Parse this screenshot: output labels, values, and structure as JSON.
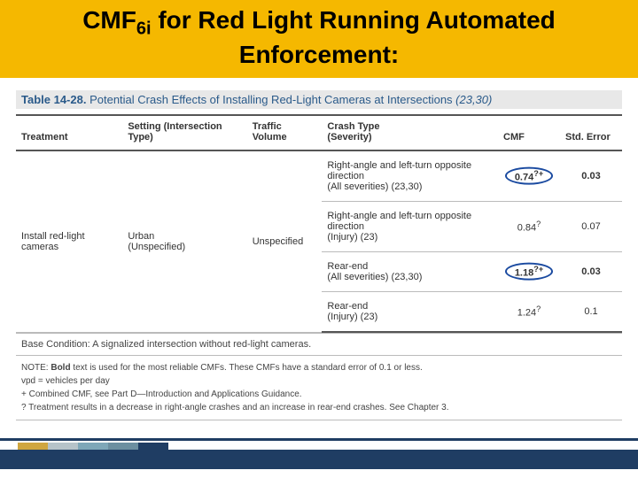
{
  "title": {
    "prefix": "CMF",
    "sub": "6i",
    "rest": " for Red Light Running Automated Enforcement:"
  },
  "table": {
    "label_num": "Table 14-28.",
    "label_rest": " Potential Crash Effects of Installing Red-Light Cameras at Intersections ",
    "label_refs": "(23,30)",
    "headers": {
      "treatment": "Treatment",
      "setting": "Setting (Intersection Type)",
      "volume": "Traffic Volume",
      "crashtype": "Crash Type\n(Severity)",
      "cmf": "CMF",
      "stderr": "Std. Error"
    },
    "treatment": "Install red-light cameras",
    "setting": "Urban\n(Unspecified)",
    "volume": "Unspecified",
    "rows": [
      {
        "crash": "Right-angle and left-turn opposite direction\n(All severities) (23,30)",
        "cmf": "0.74",
        "cmf_marks": "?+",
        "err": "0.03",
        "bold": true,
        "circle": true
      },
      {
        "crash": "Right-angle and left-turn opposite direction\n(Injury) (23)",
        "cmf": "0.84",
        "cmf_marks": "?",
        "err": "0.07",
        "bold": false,
        "circle": false
      },
      {
        "crash": "Rear-end\n(All severities) (23,30)",
        "cmf": "1.18",
        "cmf_marks": "?+",
        "err": "0.03",
        "bold": true,
        "circle": true
      },
      {
        "crash": "Rear-end\n(Injury) (23)",
        "cmf": "1.24",
        "cmf_marks": "?",
        "err": "0.1",
        "bold": false,
        "circle": false
      }
    ],
    "base_condition": "Base Condition: A signalized intersection without red-light cameras."
  },
  "notes": {
    "lead": "NOTE: ",
    "l1a": "Bold",
    "l1b": " text is used for the most reliable CMFs. These CMFs have a standard error of 0.1 or less.",
    "l2": "vpd = vehicles per day",
    "l3": "+ Combined CMF, see Part D—Introduction and Applications Guidance.",
    "l4": "? Treatment results in a decrease in right-angle crashes and an increase in rear-end crashes. See Chapter 3."
  }
}
